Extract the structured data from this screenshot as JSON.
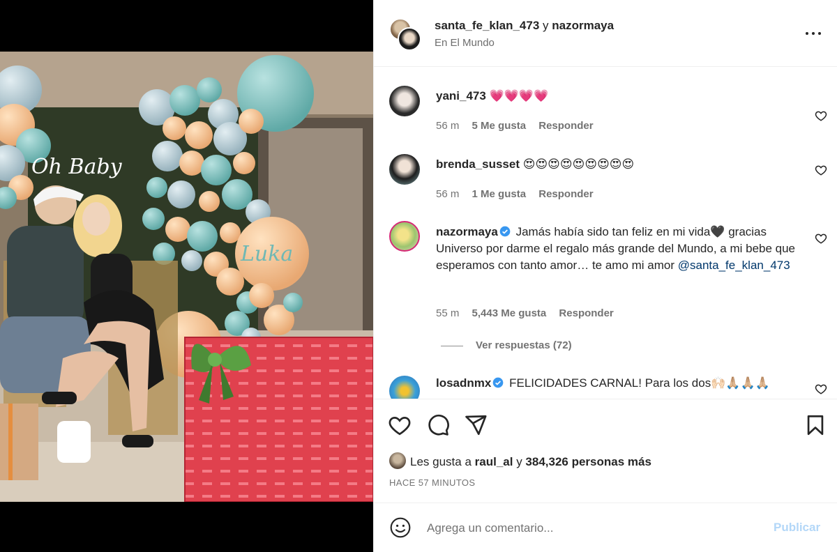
{
  "post": {
    "authors_primary": "santa_fe_klan_473",
    "authors_joiner": "y",
    "authors_secondary": "nazormaya",
    "location": "En El Mundo",
    "more_icon": "more-horizontal-icon"
  },
  "comments": [
    {
      "user": "yani_473",
      "text": "💗💗💗💗",
      "time": "56 m",
      "likes": "5 Me gusta",
      "reply": "Responder",
      "verified": false
    },
    {
      "user": "brenda_susset",
      "text": "😍😍😍😍😍😍😍😍😍",
      "time": "56 m",
      "likes": "1 Me gusta",
      "reply": "Responder",
      "verified": false
    },
    {
      "user": "nazormaya",
      "text": "Jamás había sido tan feliz en mi vida🖤 gracias Universo por darme el regalo más grande del Mundo, a mi bebe que esperamos con tanto amor… te amo mi amor ",
      "mention": "@santa_fe_klan_473",
      "time": "55 m",
      "likes": "5,443 Me gusta",
      "reply": "Responder",
      "verified": true,
      "view_replies": "Ver respuestas (72)"
    },
    {
      "user": "losadnmx",
      "text": "FELICIDADES CARNAL! Para los dos🙌🏻🙏🏼🙏🏼🙏🏼",
      "verified": true
    }
  ],
  "actions": {
    "like_icon": "heart-icon",
    "comment_icon": "comment-icon",
    "share_icon": "send-icon",
    "save_icon": "bookmark-icon"
  },
  "likes": {
    "prefix": "Les gusta a",
    "user": "raul_al",
    "joiner": "y",
    "others": "384,326 personas más"
  },
  "post_time": "HACE 57 MINUTOS",
  "composer": {
    "emoji_icon": "emoji-icon",
    "placeholder": "Agrega un comentario...",
    "publish": "Publicar"
  },
  "photo_texts": {
    "neon_sign": "Oh Baby",
    "balloon_name": "Luka"
  }
}
